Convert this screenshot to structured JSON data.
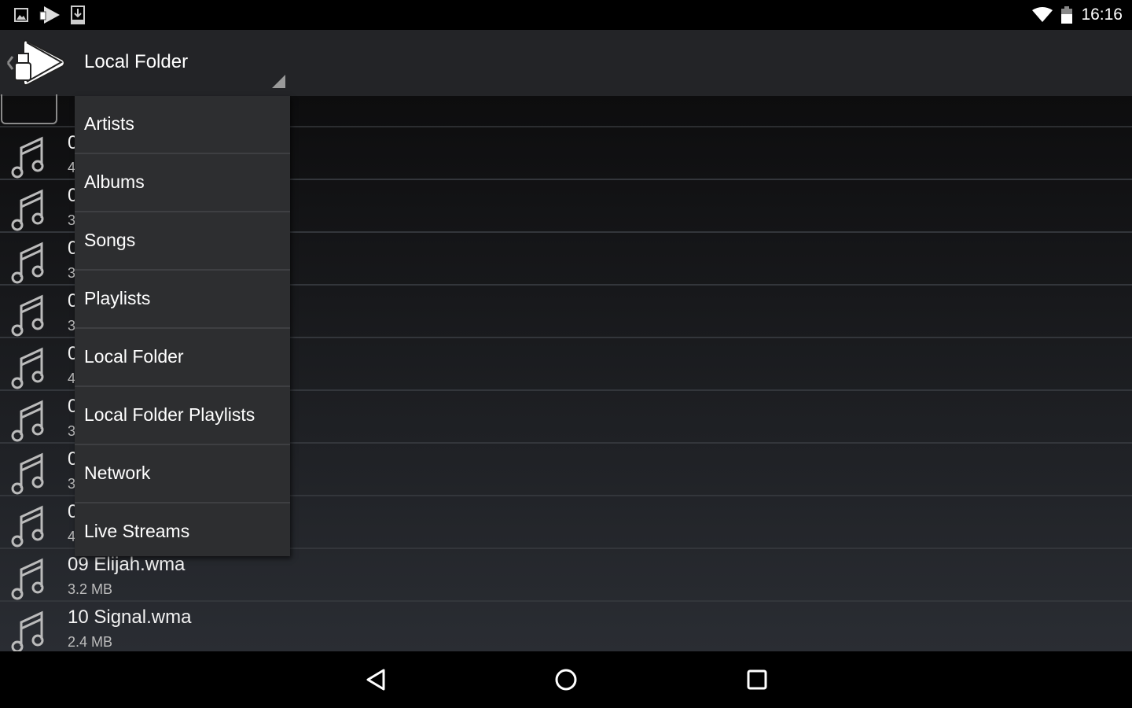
{
  "status_bar": {
    "notification_icons": [
      "image-icon",
      "app-logo-icon",
      "download-icon"
    ],
    "system_icons": [
      "wifi-icon",
      "battery-icon"
    ],
    "time": "16:16"
  },
  "action_bar": {
    "logo_icon": "usb-play-logo-icon",
    "spinner_value": "Local Folder"
  },
  "dropdown": {
    "items": [
      {
        "label": "Artists"
      },
      {
        "label": "Albums"
      },
      {
        "label": "Songs"
      },
      {
        "label": "Playlists"
      },
      {
        "label": "Local Folder"
      },
      {
        "label": "Local Folder Playlists"
      },
      {
        "label": "Network"
      },
      {
        "label": "Live Streams"
      }
    ]
  },
  "files": [
    {
      "name": "0",
      "size": "4"
    },
    {
      "name": "0",
      "size": "3"
    },
    {
      "name": "0",
      "size": "3"
    },
    {
      "name": "0",
      "size": "3"
    },
    {
      "name": "0",
      "size": "4"
    },
    {
      "name": "0",
      "size": "3"
    },
    {
      "name": "0",
      "size": "3"
    },
    {
      "name": "0",
      "size": "4"
    },
    {
      "name": "09 Elijah.wma",
      "size": "3.2 MB"
    },
    {
      "name": "10 Signal.wma",
      "size": "2.4 MB"
    }
  ],
  "nav_bar": {
    "icons": [
      "back-icon",
      "home-icon",
      "recents-icon"
    ]
  }
}
